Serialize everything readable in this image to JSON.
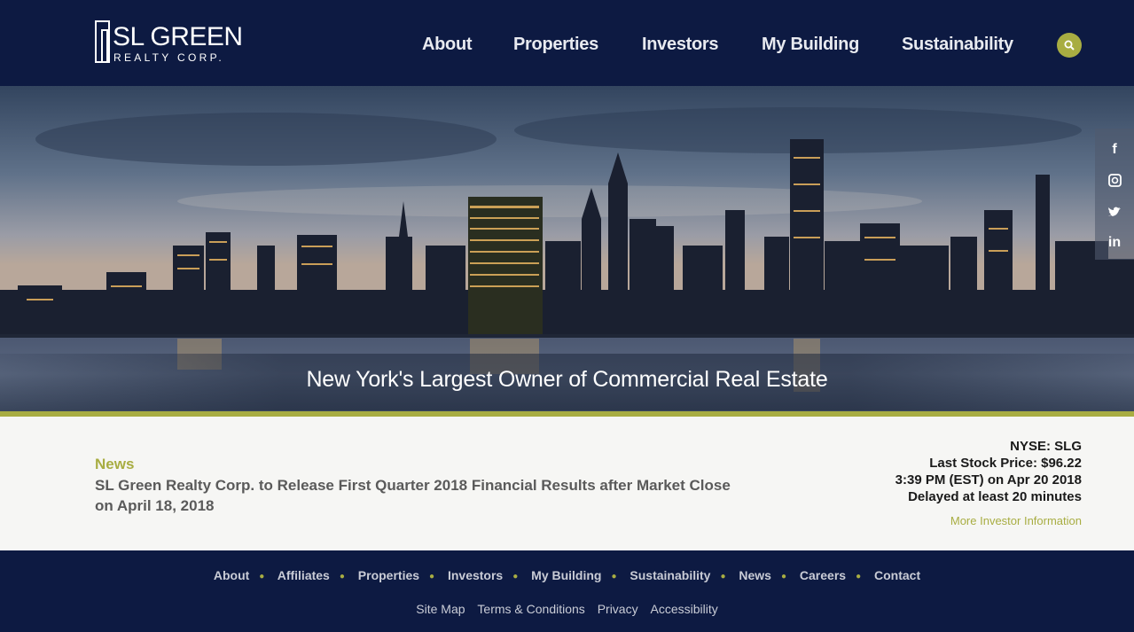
{
  "header": {
    "logo_name": "SL GREEN",
    "logo_sub": "REALTY CORP.",
    "nav": [
      "About",
      "Properties",
      "Investors",
      "My Building",
      "Sustainability"
    ],
    "search_icon": "search-icon"
  },
  "hero": {
    "caption": "New York's Largest Owner of Commercial Real Estate",
    "social": [
      "f",
      "ig",
      "tw",
      "in"
    ]
  },
  "news": {
    "label": "News",
    "headline": "SL Green Realty Corp. to Release First Quarter 2018 Financial Results after Market Close on April 18, 2018"
  },
  "stock": {
    "exchange": "NYSE: SLG",
    "price": "Last Stock Price: $96.22",
    "time": "3:39 PM (EST) on Apr 20 2018",
    "delay": "Delayed at least 20 minutes",
    "more_link": "More Investor Information"
  },
  "footer": {
    "nav": [
      "About",
      "Affiliates",
      "Properties",
      "Investors",
      "My Building",
      "Sustainability",
      "News",
      "Careers",
      "Contact"
    ],
    "legal": [
      "Site Map",
      "Terms & Conditions",
      "Privacy",
      "Accessibility"
    ]
  },
  "colors": {
    "navy": "#0d1a42",
    "accent": "#a8ad42",
    "news_bg": "#f6f6f4"
  }
}
